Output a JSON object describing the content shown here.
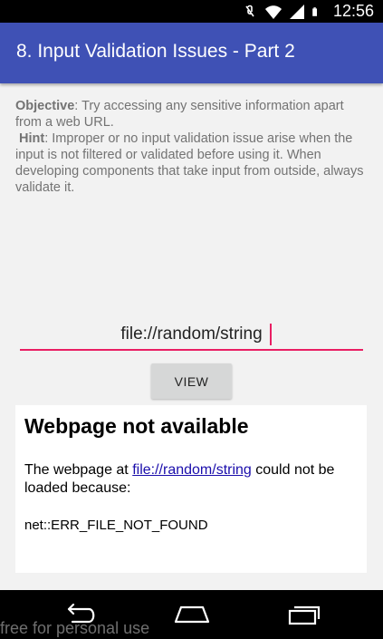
{
  "status_bar": {
    "time": "12:56",
    "icons": [
      "mute-icon",
      "wifi-icon",
      "signal-icon",
      "battery-icon"
    ]
  },
  "app_bar": {
    "title": "8. Input Validation Issues - Part 2",
    "color": "#3f51b5"
  },
  "description": {
    "objective_label": "Objective",
    "objective_text": ": Try accessing any sensitive information apart from a web URL.",
    "hint_label": "Hint",
    "hint_text": ": Improper or no input validation issue arise when the input is not filtered or validated before using it. When developing components that take input from outside, always validate it."
  },
  "url_input": {
    "value": "file://random/string",
    "accent": "#e91e63"
  },
  "view_button": {
    "label": "VIEW"
  },
  "webview": {
    "title": "Webpage not available",
    "text_before": "The webpage at ",
    "link": "file://random/string",
    "text_after": " could not be loaded because:",
    "error": "net::ERR_FILE_NOT_FOUND"
  },
  "nav_bar": {
    "icons": [
      "back-icon",
      "home-icon",
      "recents-icon"
    ]
  },
  "watermark": "free for personal use"
}
